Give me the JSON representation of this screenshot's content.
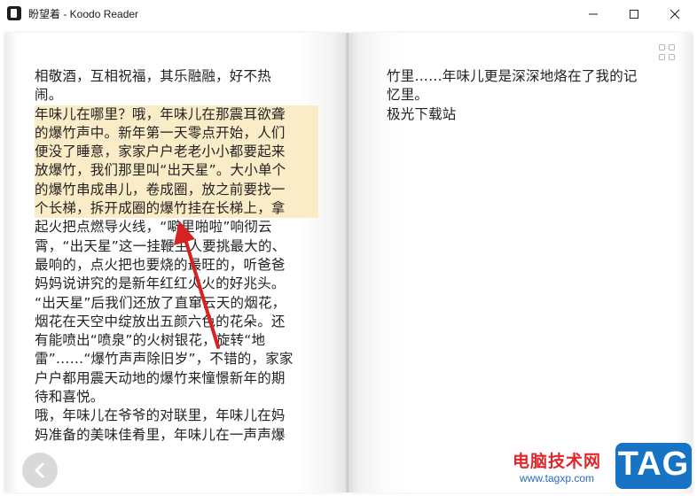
{
  "window": {
    "title": "盼望着 - Koodo Reader"
  },
  "left_page": {
    "lines": [
      {
        "text": "相敬酒，互相祝福，其乐融融，好不热",
        "highlighted": false
      },
      {
        "text": "闹。",
        "highlighted": false
      },
      {
        "text": "年味儿在哪里？哦，年味儿在那震耳欲聋",
        "highlighted": true
      },
      {
        "text": "的爆竹声中。新年第一天零点开始，人们",
        "highlighted": true
      },
      {
        "text": "便没了睡意，家家户户老老小小都要起来",
        "highlighted": true
      },
      {
        "text": "放爆竹，我们那里叫“出天星”。大小单个",
        "highlighted": true
      },
      {
        "text": "的爆竹串成串儿，卷成圈，放之前要找一",
        "highlighted": true
      },
      {
        "text": "个长梯，拆开成圈的爆竹挂在长梯上，拿",
        "highlighted": true
      },
      {
        "text": "起火把点燃导火线，“噼里啪啦”响彻云",
        "highlighted": false
      },
      {
        "text": "霄，“出天星”这一挂鞭主人要挑最大的、",
        "highlighted": false
      },
      {
        "text": "最响的，点火把也要烧的最旺的，听爸爸",
        "highlighted": false
      },
      {
        "text": "妈妈说讲究的是新年红红火火的好兆头。",
        "highlighted": false
      },
      {
        "text": "“出天星”后我们还放了直窜云天的烟花，",
        "highlighted": false
      },
      {
        "text": "烟花在天空中绽放出五颜六色的花朵。还",
        "highlighted": false
      },
      {
        "text": "有能喷出“喷泉”的火树银花，旋转“地",
        "highlighted": false
      },
      {
        "text": "雷”……“爆竹声声除旧岁”，不错的，家家",
        "highlighted": false
      },
      {
        "text": "户户都用震天动地的爆竹来憧憬新年的期",
        "highlighted": false
      },
      {
        "text": "待和喜悦。",
        "highlighted": false
      },
      {
        "text": "哦，年味儿在爷爷的对联里，年味儿在妈",
        "highlighted": false
      },
      {
        "text": "妈准备的美味佳肴里，年味儿在一声声爆",
        "highlighted": false
      }
    ]
  },
  "right_page": {
    "lines": [
      {
        "text": "竹里……年味儿更是深深地烙在了我的记"
      },
      {
        "text": "忆里。"
      },
      {
        "text": "极光下载站"
      }
    ]
  },
  "icons": {
    "app": "koodo-reader-app-icon",
    "grid": "grid-view-icon",
    "prev": "chevron-left-icon",
    "minimize": "minimize-icon",
    "maximize": "maximize-icon",
    "close": "close-icon"
  },
  "watermark": {
    "site_name": "电脑技术网",
    "url": "www.tagxp.com",
    "tag": "TAG"
  },
  "colors": {
    "highlight": "#fbecc8",
    "annotation_arrow": "#d62222",
    "text": "#222222",
    "tag_badge": "#1774c4"
  }
}
